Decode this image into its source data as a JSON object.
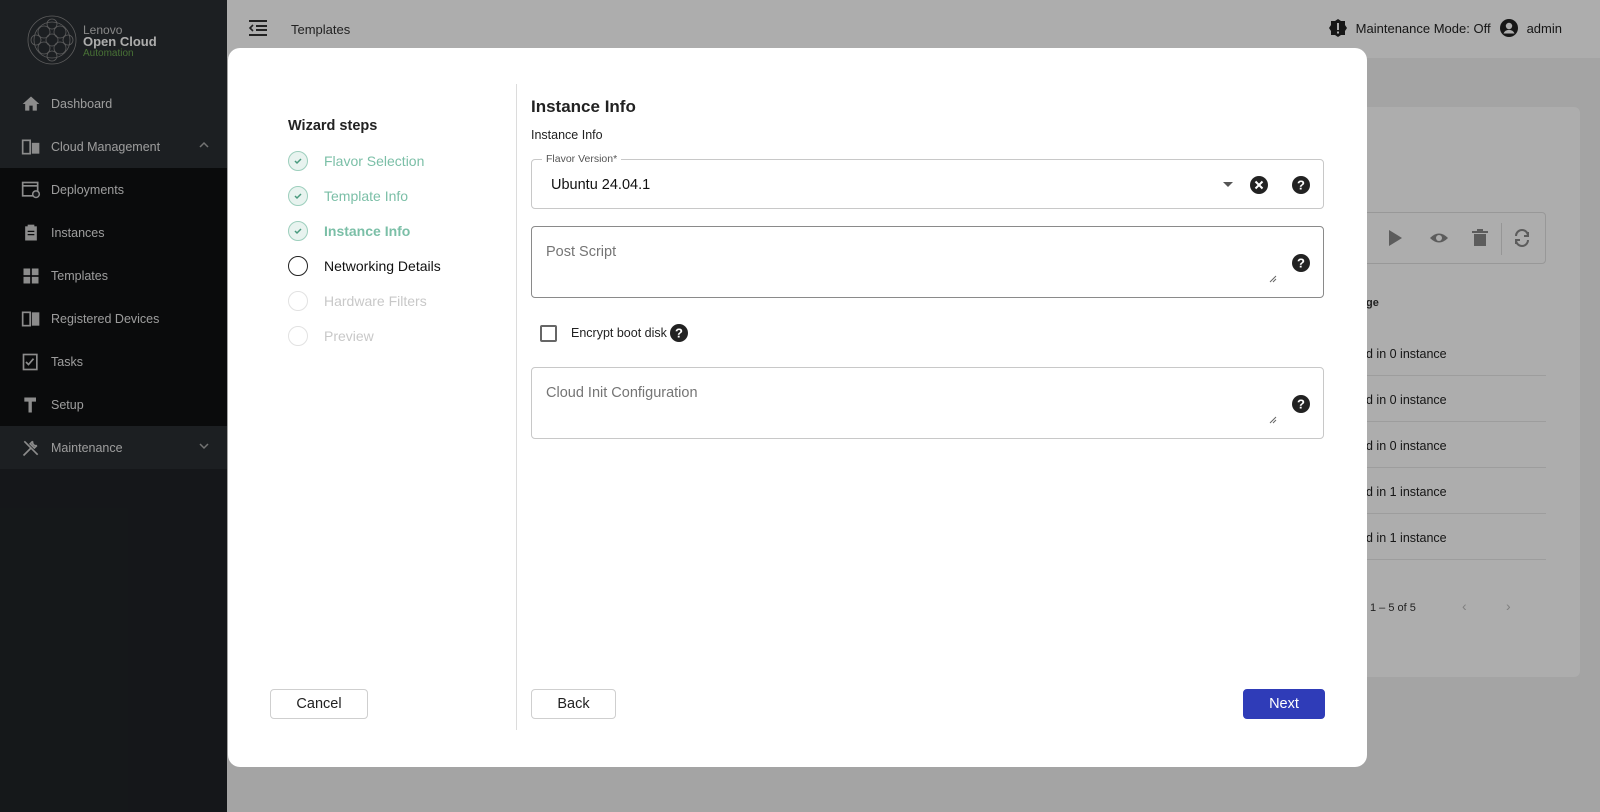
{
  "brand": {
    "line1": "Lenovo",
    "line2": "Open Cloud",
    "line3": "Automation"
  },
  "sidebar": {
    "items": [
      {
        "label": "Dashboard",
        "icon": "home-icon"
      },
      {
        "label": "Cloud Management",
        "icon": "cloud-management-icon"
      },
      {
        "label": "Deployments",
        "icon": "deployments-icon"
      },
      {
        "label": "Instances",
        "icon": "instances-icon"
      },
      {
        "label": "Templates",
        "icon": "templates-icon"
      },
      {
        "label": "Registered Devices",
        "icon": "registered-devices-icon"
      },
      {
        "label": "Tasks",
        "icon": "tasks-icon"
      },
      {
        "label": "Setup",
        "icon": "setup-icon"
      },
      {
        "label": "Maintenance",
        "icon": "maintenance-icon"
      }
    ]
  },
  "topbar": {
    "breadcrumb": "Templates",
    "maintenance_mode": "Maintenance Mode: Off",
    "user": "admin"
  },
  "background": {
    "table_header": "ge",
    "rows": [
      "d in 0 instance",
      "d in 0 instance",
      "d in 0 instance",
      "d in 1 instance",
      "d in 1 instance"
    ],
    "pagination": "1 – 5 of 5"
  },
  "wizard": {
    "title": "Wizard steps",
    "steps": [
      {
        "label": "Flavor Selection",
        "state": "done"
      },
      {
        "label": "Template Info",
        "state": "done"
      },
      {
        "label": "Instance Info",
        "state": "active"
      },
      {
        "label": "Networking Details",
        "state": "current"
      },
      {
        "label": "Hardware Filters",
        "state": "pending"
      },
      {
        "label": "Preview",
        "state": "pending"
      }
    ],
    "cancel_label": "Cancel",
    "back_label": "Back",
    "next_label": "Next"
  },
  "form": {
    "title": "Instance Info",
    "subtitle": "Instance Info",
    "flavor_version": {
      "label": "Flavor Version*",
      "value": "Ubuntu 24.04.1"
    },
    "post_script": {
      "placeholder": "Post Script"
    },
    "encrypt_boot_disk": {
      "label": "Encrypt boot disk",
      "checked": false
    },
    "cloud_init": {
      "placeholder": "Cloud Init Configuration"
    }
  },
  "colors": {
    "sidebar_bg": "#1f2327",
    "step_done": "#7bbfa7",
    "primary_button": "#2f3cb8",
    "brand_green": "#6aa84f"
  }
}
